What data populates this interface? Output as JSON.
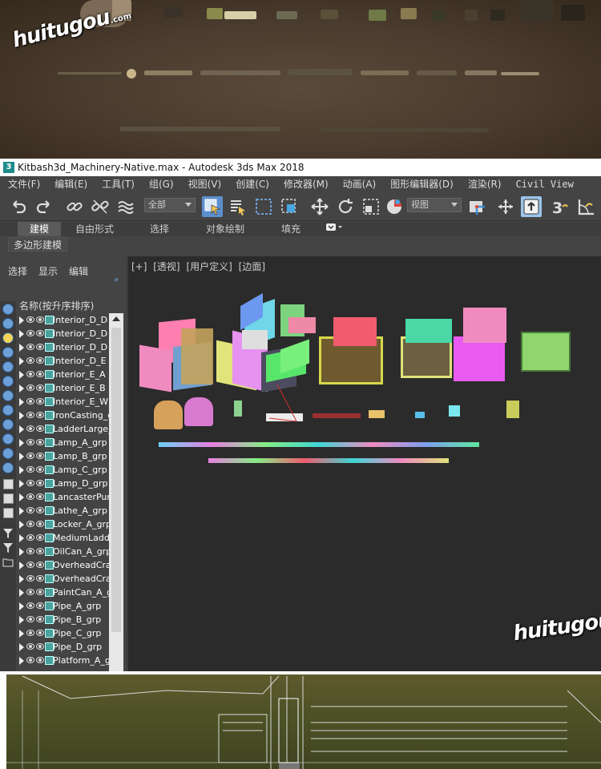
{
  "watermark": {
    "main": "huitugou",
    "sub": ".com"
  },
  "window": {
    "title": "Kitbash3d_Machinery-Native.max - Autodesk 3ds Max 2018",
    "app_icon": "3"
  },
  "menubar": [
    "文件(F)",
    "编辑(E)",
    "工具(T)",
    "组(G)",
    "视图(V)",
    "创建(C)",
    "修改器(M)",
    "动画(A)",
    "图形编辑器(D)",
    "渲染(R)",
    "Civil View"
  ],
  "toolbar": {
    "selection_filter": "全部",
    "ref_coord": "视图",
    "icons": [
      "undo-icon",
      "redo-icon",
      "link-icon",
      "unlink-icon",
      "bind-spacewarp-icon",
      "select-object-icon",
      "select-by-name-icon",
      "rect-region-icon",
      "window-crossing-icon",
      "move-icon",
      "rotate-icon",
      "scale-icon",
      "place-icon",
      "pivot-icon",
      "select-manipulate-icon",
      "snap-toggle-icon",
      "angle-snap-icon"
    ]
  },
  "ribbon": {
    "tabs": [
      "建模",
      "自由形式",
      "选择",
      "对象绘制",
      "填充"
    ],
    "sub_label": "多边形建模"
  },
  "explorer": {
    "menu": [
      "选择",
      "显示",
      "编辑"
    ],
    "header": "名称(按升序排序)",
    "items": [
      "Interior_D_D",
      "Interior_D_D",
      "Interior_D_D",
      "Interior_D_E",
      "Interior_E_A",
      "Interior_E_B",
      "Interior_E_W",
      "IronCasting_g",
      "LadderLarge_",
      "Lamp_A_grp",
      "Lamp_B_grp",
      "Lamp_C_grp",
      "Lamp_D_grp",
      "LancasterPum",
      "Lathe_A_grp",
      "Locker_A_grp",
      "MediumLadde",
      "OilCan_A_grp",
      "OverheadCra",
      "OverheadCra",
      "PaintCan_A_g",
      "Pipe_A_grp",
      "Pipe_B_grp",
      "Pipe_C_grp",
      "Pipe_D_grp",
      "Platform_A_gr"
    ]
  },
  "viewport": {
    "labels": [
      "[+]",
      "[透视]",
      "[用户定义]",
      "[边面]"
    ]
  },
  "colors": {
    "accent": "#5b8fcf",
    "panel": "#444444",
    "viewport_bg": "#2b2b2b"
  }
}
